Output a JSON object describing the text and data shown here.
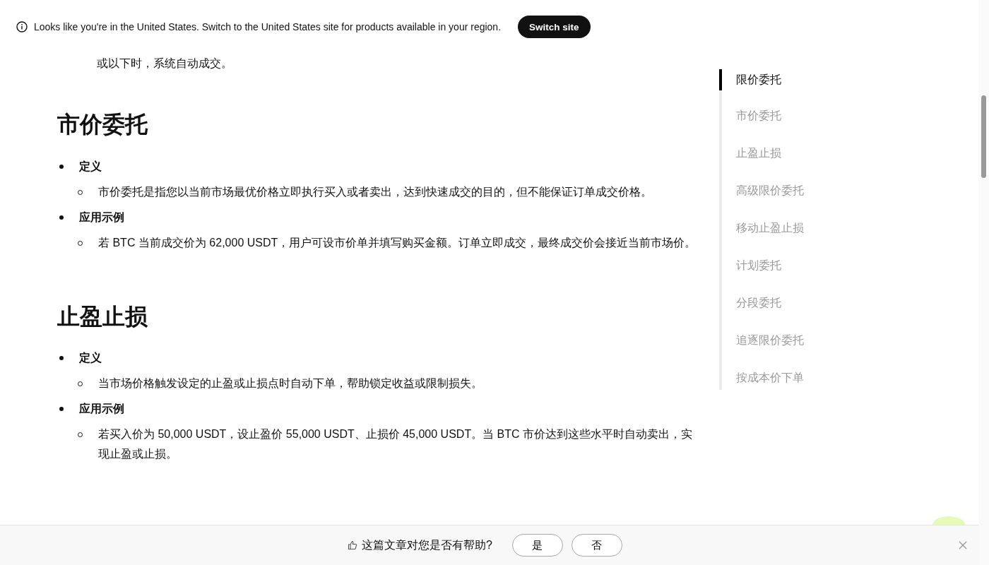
{
  "banner": {
    "message": "Looks like you're in the United States. Switch to the United States site for products available in your region.",
    "button": "Switch site"
  },
  "article": {
    "lead_text": "或以下时，系统自动成交。",
    "sections": [
      {
        "heading": "市价委托",
        "items": [
          {
            "label": "定义",
            "text": "市价委托是指您以当前市场最优价格立即执行买入或者卖出，达到快速成交的目的，但不能保证订单成交价格。"
          },
          {
            "label": "应用示例",
            "text": "若 BTC 当前成交价为 62,000 USDT，用户可设市价单并填写购买金额。订单立即成交，最终成交价会接近当前市场价。"
          }
        ]
      },
      {
        "heading": "止盈止损",
        "items": [
          {
            "label": "定义",
            "text": "当市场价格触发设定的止盈或止损点时自动下单，帮助锁定收益或限制损失。"
          },
          {
            "label": "应用示例",
            "text": "若买入价为 50,000 USDT，设止盈价 55,000 USDT、止损价 45,000 USDT。当 BTC 市价达到这些水平时自动卖出，实现止盈或止损。"
          }
        ]
      }
    ]
  },
  "toc": [
    {
      "label": "限价委托",
      "selected": true
    },
    {
      "label": "市价委托",
      "selected": false
    },
    {
      "label": "止盈止损",
      "selected": false
    },
    {
      "label": "高级限价委托",
      "selected": false
    },
    {
      "label": "移动止盈止损",
      "selected": false
    },
    {
      "label": "计划委托",
      "selected": false
    },
    {
      "label": "分段委托",
      "selected": false
    },
    {
      "label": "追逐限价委托",
      "selected": false
    },
    {
      "label": "按成本价下单",
      "selected": false
    }
  ],
  "feedback": {
    "question": "这篇文章对您是否有帮助?",
    "buttons": [
      "是",
      "否"
    ]
  }
}
